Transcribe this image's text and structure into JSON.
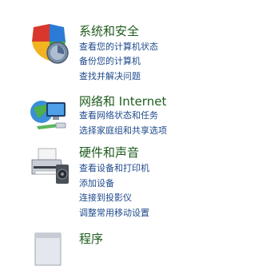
{
  "categories": [
    {
      "title": "系统和安全",
      "icon": "shield-icon",
      "links": [
        "查看您的计算机状态",
        "备份您的计算机",
        "查找并解决问题"
      ]
    },
    {
      "title": "网络和 Internet",
      "icon": "network-globe-icon",
      "links": [
        "查看网络状态和任务",
        "选择家庭组和共享选项"
      ]
    },
    {
      "title": "硬件和声音",
      "icon": "printer-icon",
      "links": [
        "查看设备和打印机",
        "添加设备",
        "连接到投影仪",
        "调整常用移动设置"
      ]
    },
    {
      "title": "程序",
      "icon": "programs-icon",
      "links": []
    }
  ],
  "colors": {
    "title": "#1e5c1e",
    "link": "#1e4a8c",
    "background": "#ffffff"
  }
}
